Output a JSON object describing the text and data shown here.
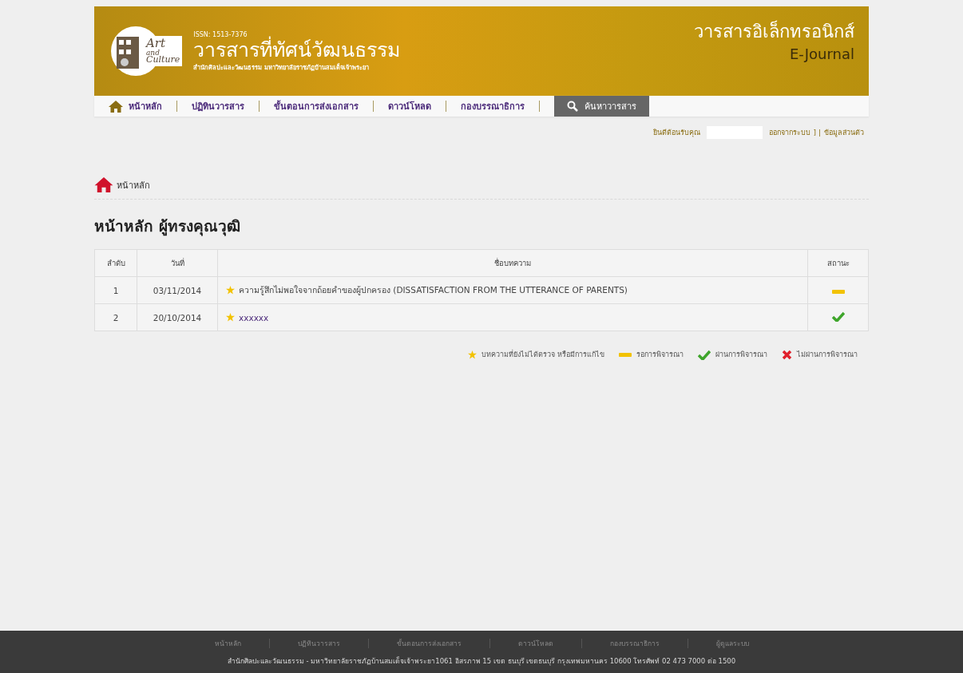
{
  "header": {
    "logo_lines": [
      "Art",
      "and",
      "Culture"
    ],
    "issn": "ISSN: 1513-7376",
    "title": "วารสารที่ทัศน์วัฒนธรรม",
    "subtitle": "สำนักศิลปะและวัฒนธรรม มหาวิทยาลัยราชภัฏบ้านสมเด็จเจ้าพระยา",
    "ejournal_thai": "วารสารอิเล็กทรอนิกส์",
    "ejournal": "E-Journal"
  },
  "nav": [
    {
      "label": "หน้าหลัก",
      "kind": "home"
    },
    {
      "label": "ปฏิทินวารสาร",
      "kind": "link"
    },
    {
      "label": "ขั้นตอนการส่งเอกสาร",
      "kind": "link"
    },
    {
      "label": "ดาวน์โหลด",
      "kind": "link"
    },
    {
      "label": "กองบรรณาธิการ",
      "kind": "link"
    },
    {
      "label": "ค้นหาวารสาร",
      "kind": "search"
    }
  ],
  "user_bar": {
    "welcome": "ยินดีต้อนรับคุณ",
    "logout": "ออกจากระบบ",
    "separator": "] |",
    "profile": "ข้อมูลส่วนตัว"
  },
  "breadcrumb": "หน้าหลัก",
  "heading": "หน้าหลัก ผู้ทรงคุณวุฒิ",
  "table": {
    "columns": [
      "ลำดับ",
      "วันที่",
      "ชื่อบทความ",
      "สถานะ"
    ],
    "rows": [
      {
        "no": "1",
        "date": "03/11/2014",
        "title": "ความรู้สึกไม่พอใจจากถ้อยคำของผู้ปกครอง (DISSATISFACTION FROM THE UTTERANCE OF PARENTS)",
        "kind": "pending"
      },
      {
        "no": "2",
        "date": "20/10/2014",
        "title": "xxxxxx",
        "kind": "passed"
      }
    ]
  },
  "legend": [
    {
      "kind": "unreviewed",
      "label": "บทความที่ยังไม่ได้ตรวจ หรือมีการแก้ไข"
    },
    {
      "kind": "pending",
      "label": "รอการพิจารณา"
    },
    {
      "kind": "passed",
      "label": "ผ่านการพิจารณา"
    },
    {
      "kind": "failed",
      "label": "ไม่ผ่านการพิจารณา"
    }
  ],
  "footer": {
    "links": [
      "หน้าหลัก",
      "ปฏิทินวารสาร",
      "ขั้นตอนการส่งเอกสาร",
      "ดาวน์โหลด",
      "กองบรรณาธิการ",
      "ผู้ดูแลระบบ"
    ],
    "address": "สำนักศิลปะและวัฒนธรรม - มหาวิทยาลัยราชภัฏบ้านสมเด็จเจ้าพระยา1061 อิสรภาพ 15 เขต ธนบุรี เขตธนบุรี กรุงเทพมหานคร 10600 โทรศัพท์ 02 473 7000 ต่อ 1500"
  }
}
